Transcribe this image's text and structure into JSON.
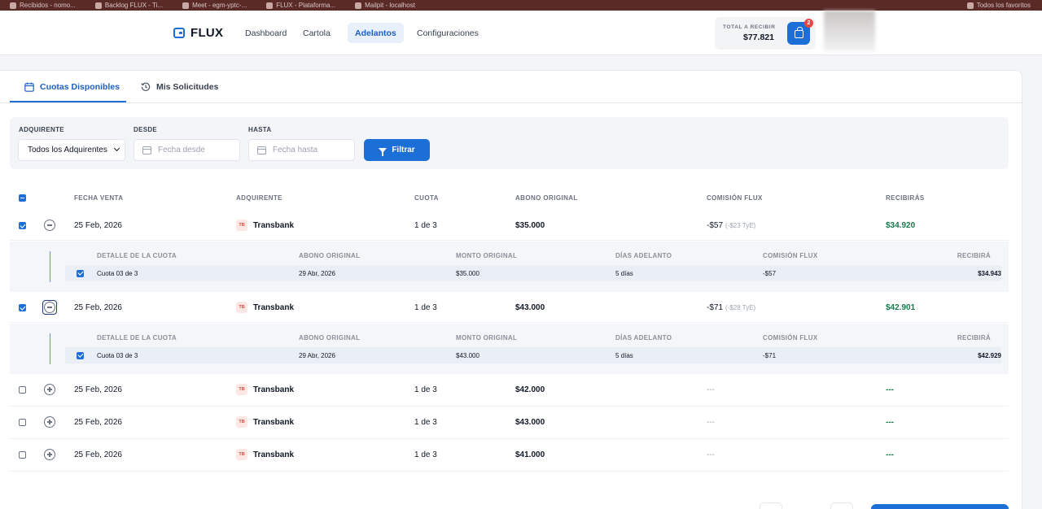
{
  "browser": {
    "bookmarks": [
      "Recibidos - nomo...",
      "Backlog FLUX - Ti...",
      "Meet - egm-yptc-...",
      "FLUX - Plataforma...",
      "Mailpit - localhost"
    ],
    "all_bookmarks": "Todos los favoritos"
  },
  "app": {
    "name": "FLUX"
  },
  "nav": {
    "items": [
      "Dashboard",
      "Cartola",
      "Adelantos",
      "Configuraciones"
    ],
    "active": "Adelantos"
  },
  "total": {
    "label": "TOTAL A RECIBIR",
    "value": "$77.821"
  },
  "cart": {
    "badge": "2"
  },
  "tabs": [
    "Cuotas Disponibles",
    "Mis Solicitudes"
  ],
  "filters": {
    "acquirer_label": "ADQUIRENTE",
    "acquirer_value": "Todos los Adquirentes",
    "from_label": "DESDE",
    "from_placeholder": "Fecha desde",
    "to_label": "HASTA",
    "to_placeholder": "Fecha hasta",
    "button": "Filtrar"
  },
  "table": {
    "columns": [
      "FECHA VENTA",
      "ADQUIRENTE",
      "CUOTA",
      "ABONO ORIGINAL",
      "COMISIÓN FLUX",
      "RECIBIRÁS"
    ],
    "rows": [
      {
        "fecha": "25 Feb, 2026",
        "badge": "TB",
        "adquirente": "Transbank",
        "cuota": "1 de 3",
        "abono": "$35.000",
        "comision": "-$57",
        "comision_sub": "(-$23 TyE)",
        "recibiras": "$34.920",
        "selected": true,
        "expanded": true
      },
      {
        "fecha": "25 Feb, 2026",
        "badge": "TB",
        "adquirente": "Transbank",
        "cuota": "1 de 3",
        "abono": "$43.000",
        "comision": "-$71",
        "comision_sub": "(-$28 TyE)",
        "recibiras": "$42.901",
        "selected": true,
        "expanded": true
      },
      {
        "fecha": "25 Feb, 2026",
        "badge": "TB",
        "adquirente": "Transbank",
        "cuota": "1 de 3",
        "abono": "$42.000",
        "comision": "---",
        "comision_sub": "",
        "recibiras": "---",
        "selected": false,
        "expanded": false
      },
      {
        "fecha": "25 Feb, 2026",
        "badge": "TB",
        "adquirente": "Transbank",
        "cuota": "1 de 3",
        "abono": "$43.000",
        "comision": "---",
        "comision_sub": "",
        "recibiras": "---",
        "selected": false,
        "expanded": false
      },
      {
        "fecha": "25 Feb, 2026",
        "badge": "TB",
        "adquirente": "Transbank",
        "cuota": "1 de 3",
        "abono": "$41.000",
        "comision": "---",
        "comision_sub": "",
        "recibiras": "---",
        "selected": false,
        "expanded": false
      }
    ]
  },
  "detail": {
    "columns": [
      "DETALLE DE LA CUOTA",
      "ABONO ORIGINAL",
      "MONTO ORIGINAL",
      "DÍAS ADELANTO",
      "COMISIÓN FLUX",
      "RECIBIRÁ"
    ],
    "rows": [
      {
        "cuota": "Cuota 03 de 3",
        "abono": "29 Abr, 2026",
        "monto": "$35.000",
        "dias": "5 días",
        "comision": "-$57",
        "recibira": "$34.943"
      },
      {
        "cuota": "Cuota 03 de 3",
        "abono": "29 Abr, 2026",
        "monto": "$43.000",
        "dias": "5 días",
        "comision": "-$71",
        "recibira": "$42.929"
      }
    ]
  }
}
